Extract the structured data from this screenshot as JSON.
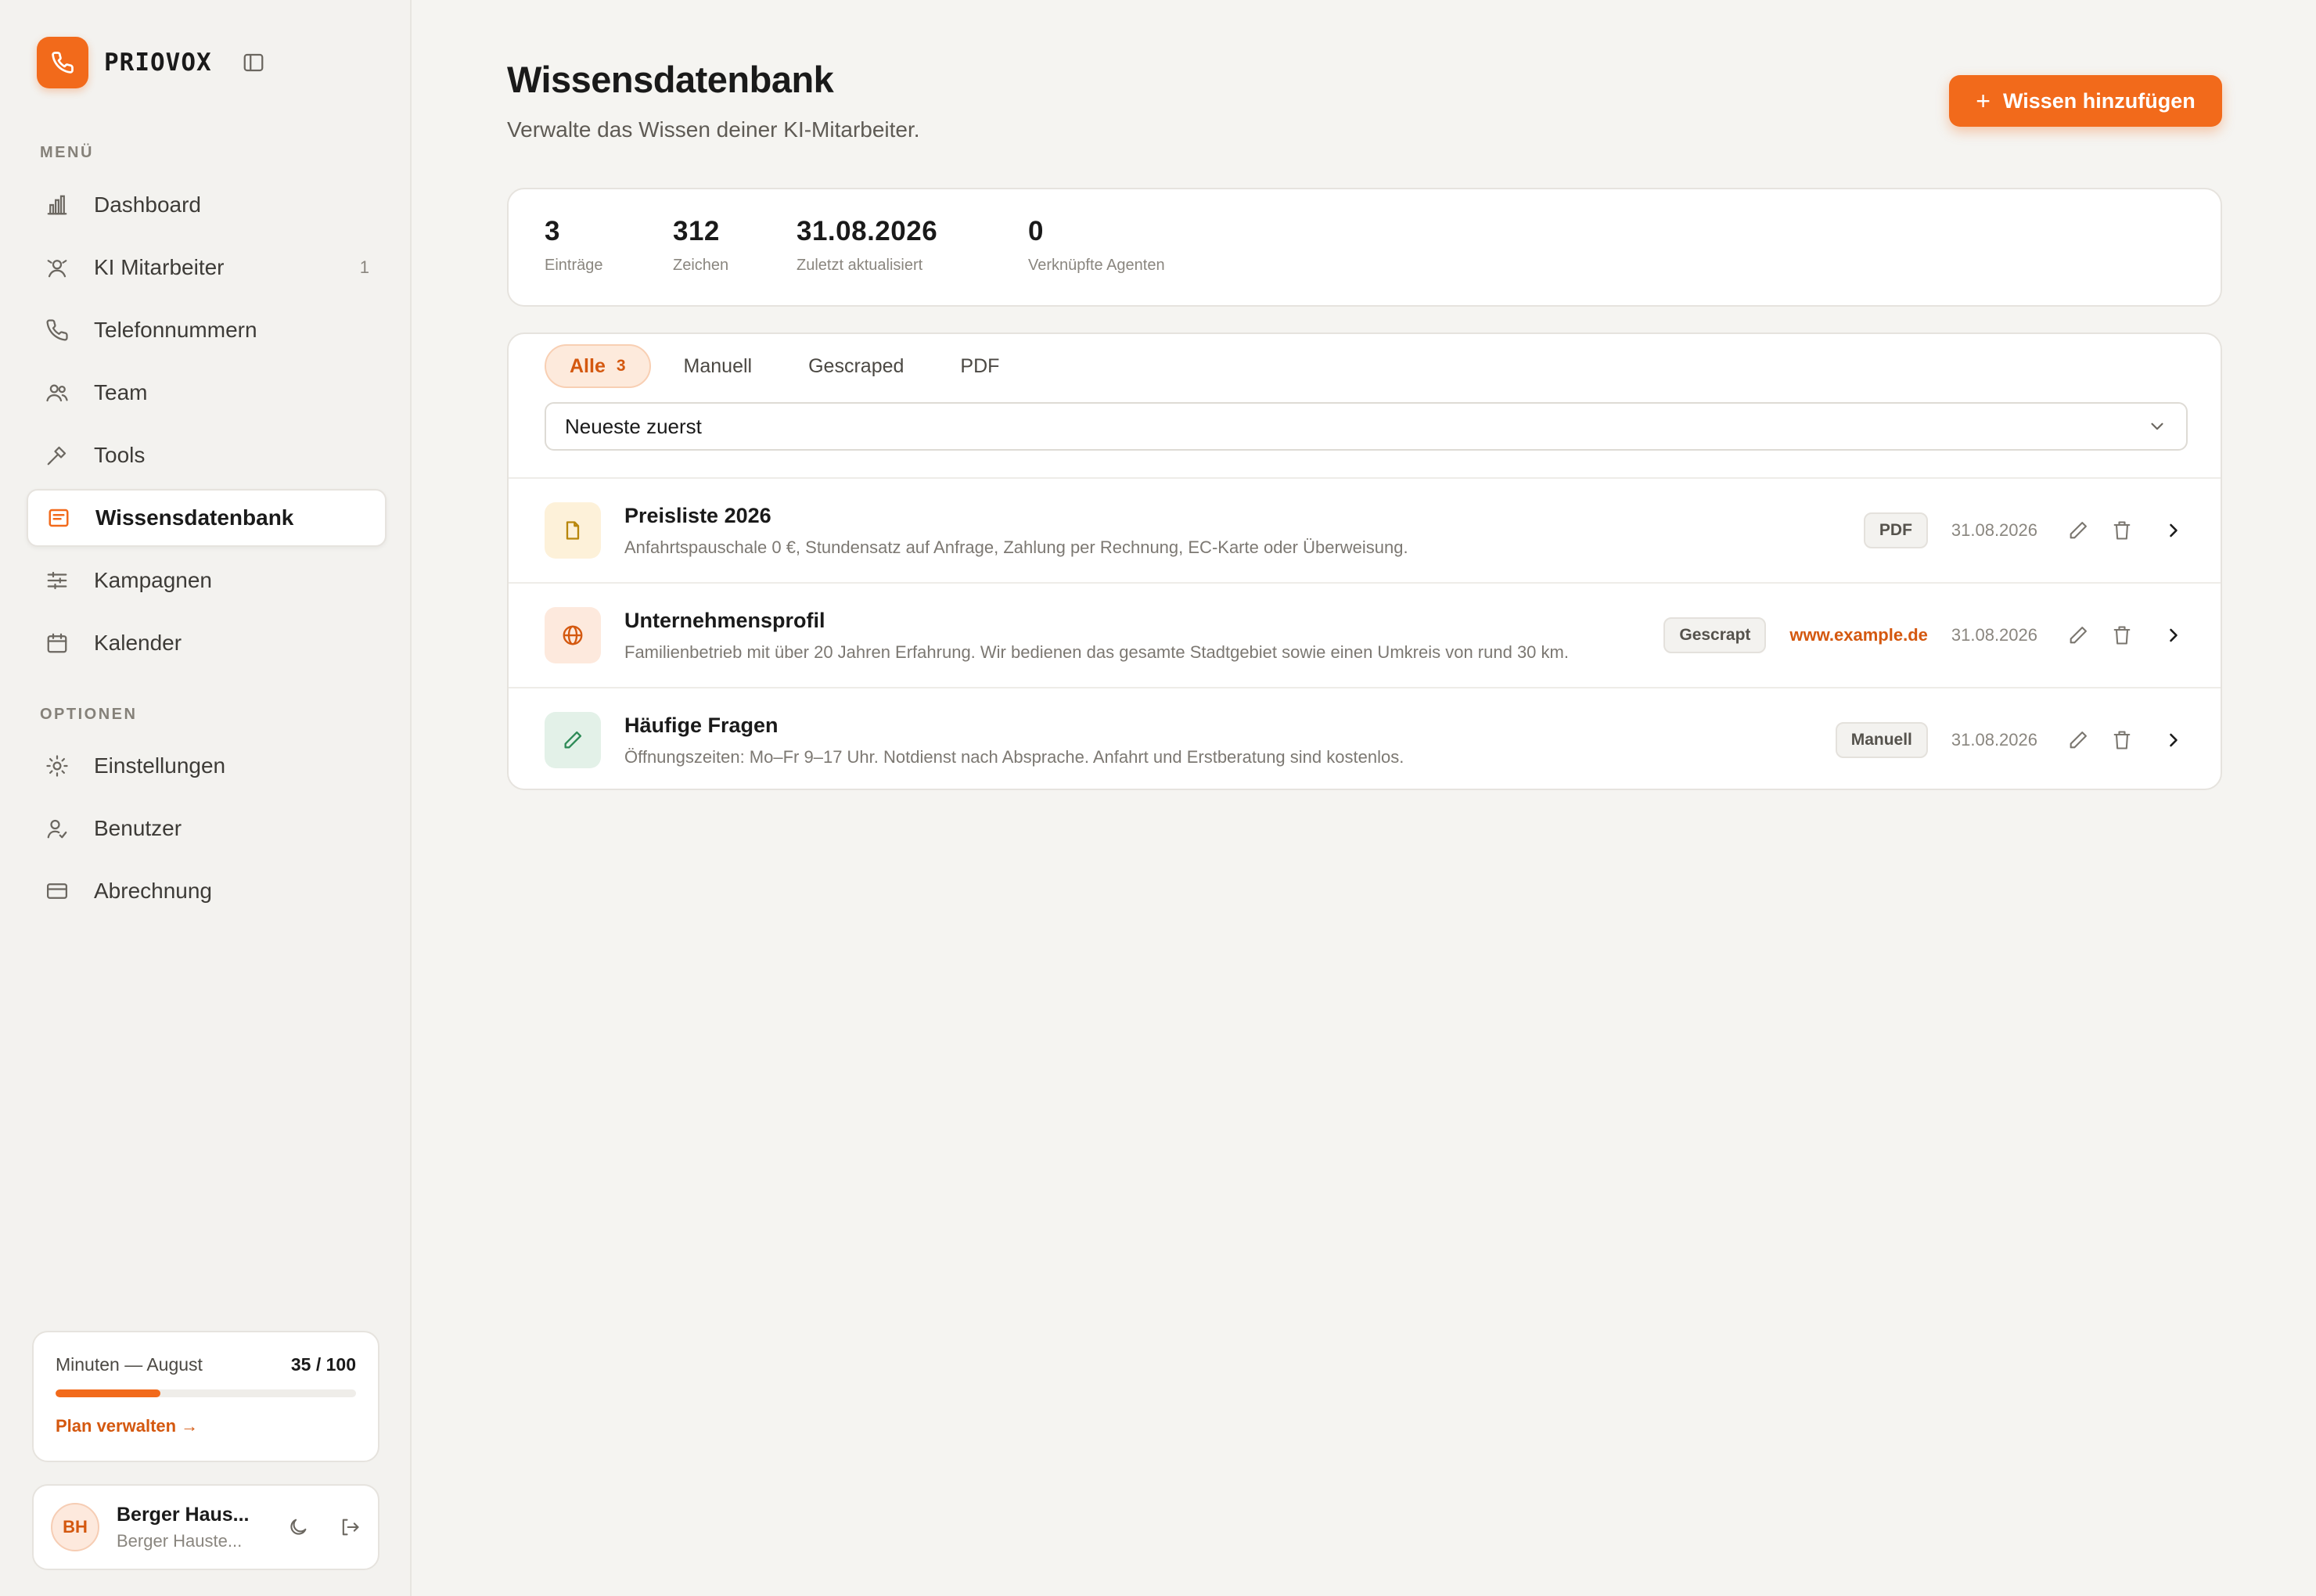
{
  "brand": {
    "name": "PRIOVOX",
    "accent": "#f26a1b"
  },
  "sidebar": {
    "menu_label": "MENÜ",
    "menu_items": [
      {
        "label": "Dashboard",
        "icon": "bar-chart-icon"
      },
      {
        "label": "KI Mitarbeiter",
        "icon": "robot-icon",
        "count": "1"
      },
      {
        "label": "Telefonnummern",
        "icon": "phone-icon"
      },
      {
        "label": "Team",
        "icon": "users-icon"
      },
      {
        "label": "Tools",
        "icon": "wrench-icon"
      },
      {
        "label": "Wissensdatenbank",
        "icon": "book-icon",
        "active": true
      },
      {
        "label": "Kampagnen",
        "icon": "sliders-icon"
      },
      {
        "label": "Kalender",
        "icon": "calendar-icon"
      }
    ],
    "options_label": "OPTIONEN",
    "option_items": [
      {
        "label": "Einstellungen",
        "icon": "sun-gear-icon"
      },
      {
        "label": "Benutzer",
        "icon": "user-check-icon"
      },
      {
        "label": "Abrechnung",
        "icon": "credit-card-icon"
      }
    ],
    "usage": {
      "label": "Minuten — August",
      "value": "35 / 100",
      "progress_fraction": 0.35,
      "link": "Plan verwalten →"
    },
    "user": {
      "initials": "BH",
      "name": "Berger Haus...",
      "org": "Berger Hauste..."
    }
  },
  "main": {
    "title": "Wissensdatenbank",
    "subtitle": "Verwalte das Wissen deiner KI-Mitarbeiter.",
    "add_button": "Wissen hinzufügen",
    "stats": [
      {
        "value": "3",
        "label": "Einträge"
      },
      {
        "value": "312",
        "label": "Zeichen"
      },
      {
        "value": "31.08.2026",
        "label": "Zuletzt aktualisiert"
      },
      {
        "value": "0",
        "label": "Verknüpfte Agenten"
      }
    ],
    "tabs": [
      {
        "label": "Alle",
        "count": "3",
        "active": true
      },
      {
        "label": "Manuell"
      },
      {
        "label": "Gescraped"
      },
      {
        "label": "PDF"
      }
    ],
    "sort": {
      "selected": "Neueste zuerst"
    },
    "entries": [
      {
        "title": "Preisliste 2026",
        "description": "Anfahrtspauschale 0 €, Stundensatz auf Anfrage, Zahlung per Rechnung, EC-Karte oder Überweisung.",
        "badge": "PDF",
        "date": "31.08.2026",
        "icon": "document-icon",
        "icon_color": "#b8860b"
      },
      {
        "title": "Unternehmensprofil",
        "description": "Familienbetrieb mit über 20 Jahren Erfahrung. Wir bedienen das gesamte Stadtgebiet sowie einen Umkreis von rund 30 km.",
        "badge": "Gescrapt",
        "link": "www.example.de",
        "date": "31.08.2026",
        "icon": "globe-icon",
        "icon_color": "#d4580f"
      },
      {
        "title": "Häufige Fragen",
        "description": "Öffnungszeiten: Mo–Fr 9–17 Uhr. Notdienst nach Absprache. Anfahrt und Erstberatung sind kostenlos.",
        "badge": "Manuell",
        "date": "31.08.2026",
        "icon": "pencil-icon",
        "icon_color": "#2e8b57"
      }
    ]
  }
}
